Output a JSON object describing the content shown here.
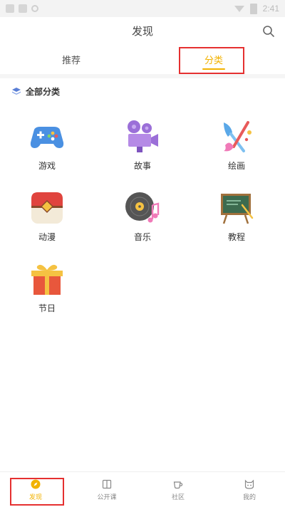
{
  "status_bar": {
    "time": "2:41"
  },
  "header": {
    "title": "发现"
  },
  "tabs": [
    {
      "label": "推荐",
      "active": false
    },
    {
      "label": "分类",
      "active": true
    }
  ],
  "section": {
    "title": "全部分类"
  },
  "categories": [
    {
      "label": "游戏",
      "icon": "gamepad-icon"
    },
    {
      "label": "故事",
      "icon": "film-camera-icon"
    },
    {
      "label": "绘画",
      "icon": "paint-brush-icon"
    },
    {
      "label": "动漫",
      "icon": "pokeball-icon"
    },
    {
      "label": "音乐",
      "icon": "vinyl-record-icon"
    },
    {
      "label": "教程",
      "icon": "chalkboard-icon"
    },
    {
      "label": "节日",
      "icon": "gift-icon"
    }
  ],
  "bottom_nav": [
    {
      "label": "发现",
      "icon": "compass-icon",
      "active": true
    },
    {
      "label": "公开课",
      "icon": "book-icon",
      "active": false
    },
    {
      "label": "社区",
      "icon": "coffee-cup-icon",
      "active": false
    },
    {
      "label": "我的",
      "icon": "cat-face-icon",
      "active": false
    }
  ],
  "colors": {
    "accent": "#f2b200",
    "highlight_box": "#e53030"
  }
}
